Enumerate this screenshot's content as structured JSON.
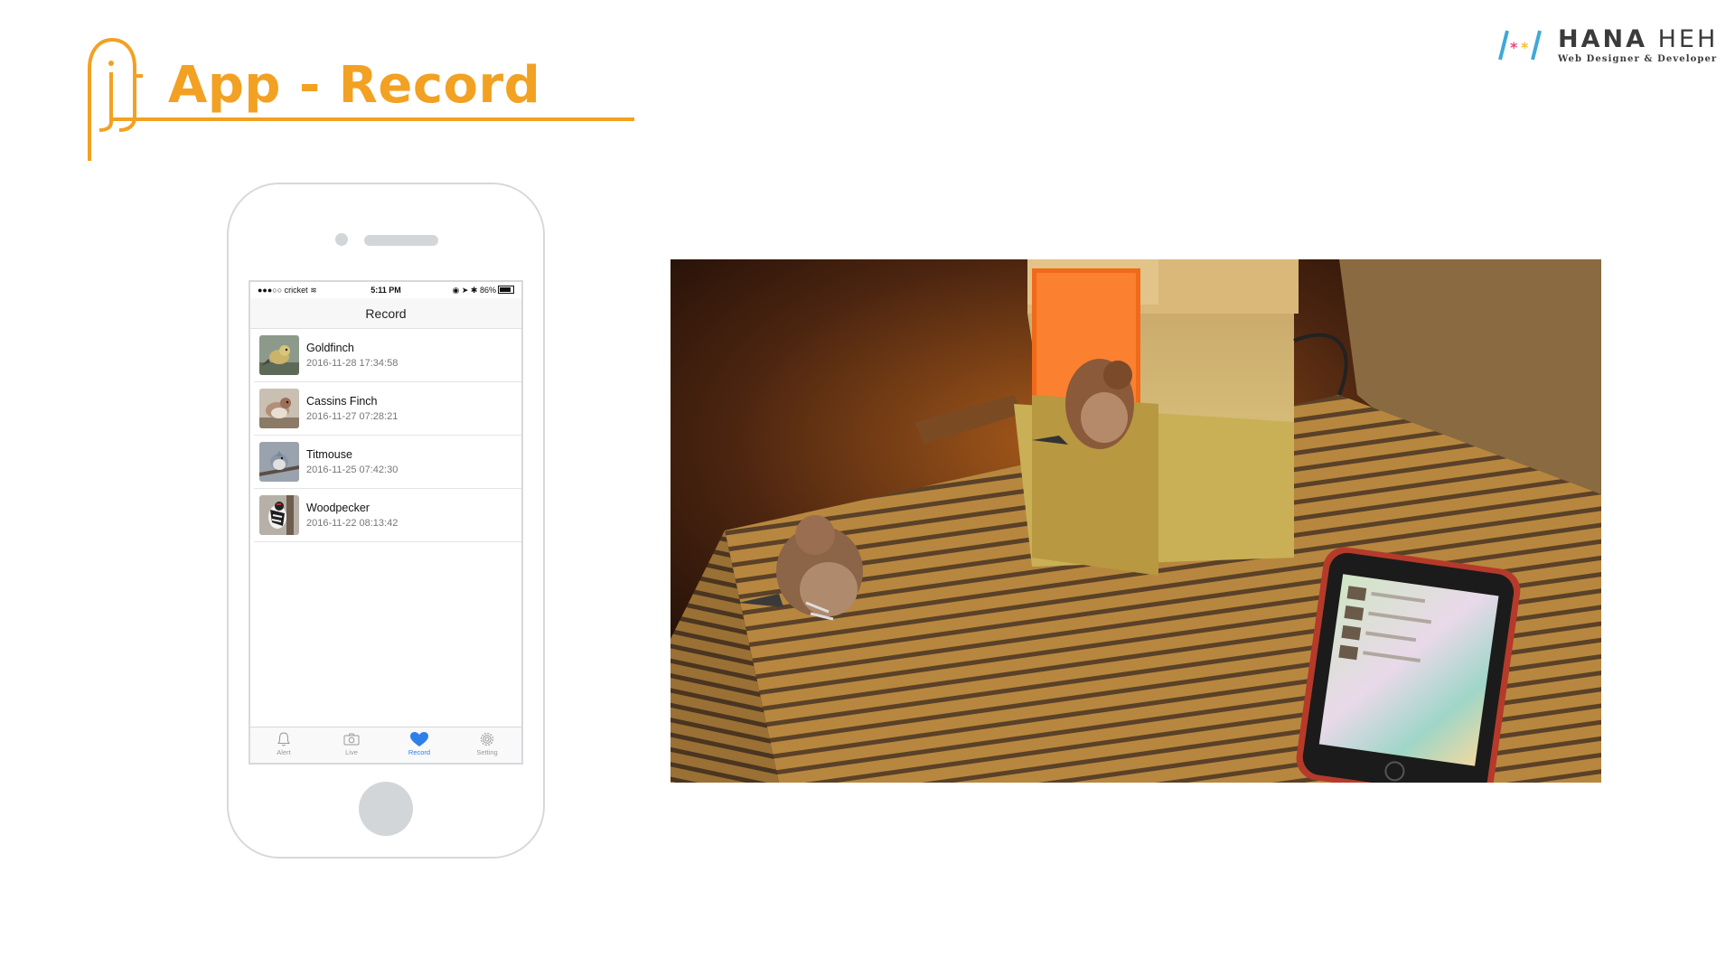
{
  "header": {
    "title": "App - Record"
  },
  "brand": {
    "name_bold": "HANA",
    "name_light": "HEH",
    "tagline": "Web Designer & Developer",
    "accent_colors": [
      "#3fa9d6",
      "#e04b7a",
      "#f2c12e"
    ]
  },
  "colors": {
    "accent": "#f2a122",
    "ios_blue": "#2f7fe8"
  },
  "phone": {
    "statusbar": {
      "carrier": "●●●○○ cricket",
      "time": "5:11 PM",
      "battery": "86%"
    },
    "nav_title": "Record",
    "records": [
      {
        "name": "Goldfinch",
        "date": "2016-11-28 17:34:58",
        "thumb": "goldfinch-photo"
      },
      {
        "name": "Cassins Finch",
        "date": "2016-11-27 07:28:21",
        "thumb": "cassins-finch-photo"
      },
      {
        "name": "Titmouse",
        "date": "2016-11-25 07:42:30",
        "thumb": "titmouse-photo"
      },
      {
        "name": "Woodpecker",
        "date": "2016-11-22 08:13:42",
        "thumb": "woodpecker-photo"
      }
    ],
    "tabs": [
      {
        "label": "Alert",
        "icon": "bell-icon"
      },
      {
        "label": "Live",
        "icon": "camera-icon"
      },
      {
        "label": "Record",
        "icon": "heart-icon",
        "active": true
      },
      {
        "label": "Setting",
        "icon": "gear-icon"
      }
    ]
  },
  "photo": {
    "subject": "bird-feeder-with-phone-photo"
  }
}
